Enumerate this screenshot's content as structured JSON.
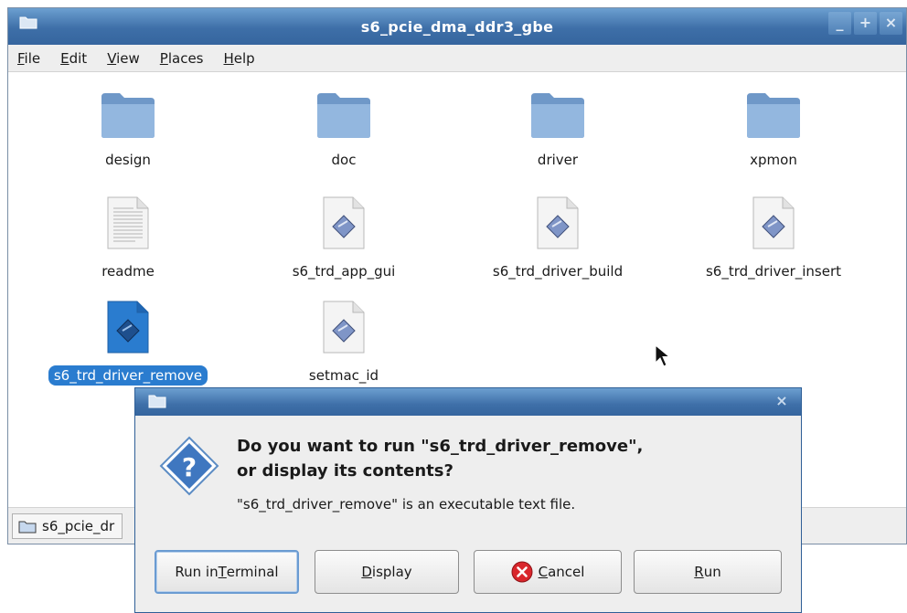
{
  "window": {
    "title": "s6_pcie_dma_ddr3_gbe",
    "controls": [
      "_",
      "+",
      "×"
    ]
  },
  "menu": [
    {
      "mnemonic": "F",
      "rest": "ile"
    },
    {
      "mnemonic": "E",
      "rest": "dit"
    },
    {
      "mnemonic": "V",
      "rest": "iew"
    },
    {
      "mnemonic": "P",
      "rest": "laces"
    },
    {
      "mnemonic": "H",
      "rest": "elp"
    }
  ],
  "files": [
    {
      "name": "design",
      "type": "folder"
    },
    {
      "name": "doc",
      "type": "folder"
    },
    {
      "name": "driver",
      "type": "folder"
    },
    {
      "name": "xpmon",
      "type": "folder"
    },
    {
      "name": "readme",
      "type": "text"
    },
    {
      "name": "s6_trd_app_gui",
      "type": "script"
    },
    {
      "name": "s6_trd_driver_build",
      "type": "script"
    },
    {
      "name": "s6_trd_driver_insert",
      "type": "script"
    },
    {
      "name": "s6_trd_driver_remove",
      "type": "script",
      "selected": true
    },
    {
      "name": "setmac_id",
      "type": "script"
    }
  ],
  "statusbar": {
    "location": "s6_pcie_dr"
  },
  "dialog": {
    "close": "×",
    "heading_line1": "Do you want to run \"s6_trd_driver_remove\",",
    "heading_line2": "or display its contents?",
    "message": "\"s6_trd_driver_remove\" is an executable text file.",
    "buttons": {
      "run_in_terminal": {
        "pre": "Run in ",
        "mnemonic": "T",
        "post": "erminal"
      },
      "display": {
        "pre": "",
        "mnemonic": "D",
        "post": "isplay"
      },
      "cancel": {
        "pre": "",
        "mnemonic": "C",
        "post": "ancel"
      },
      "run": {
        "pre": "",
        "mnemonic": "R",
        "post": "un"
      }
    }
  },
  "colors": {
    "titlebar": "#3e6fa8",
    "selection": "#2a7ccf",
    "folder": "#8fb3dd"
  }
}
